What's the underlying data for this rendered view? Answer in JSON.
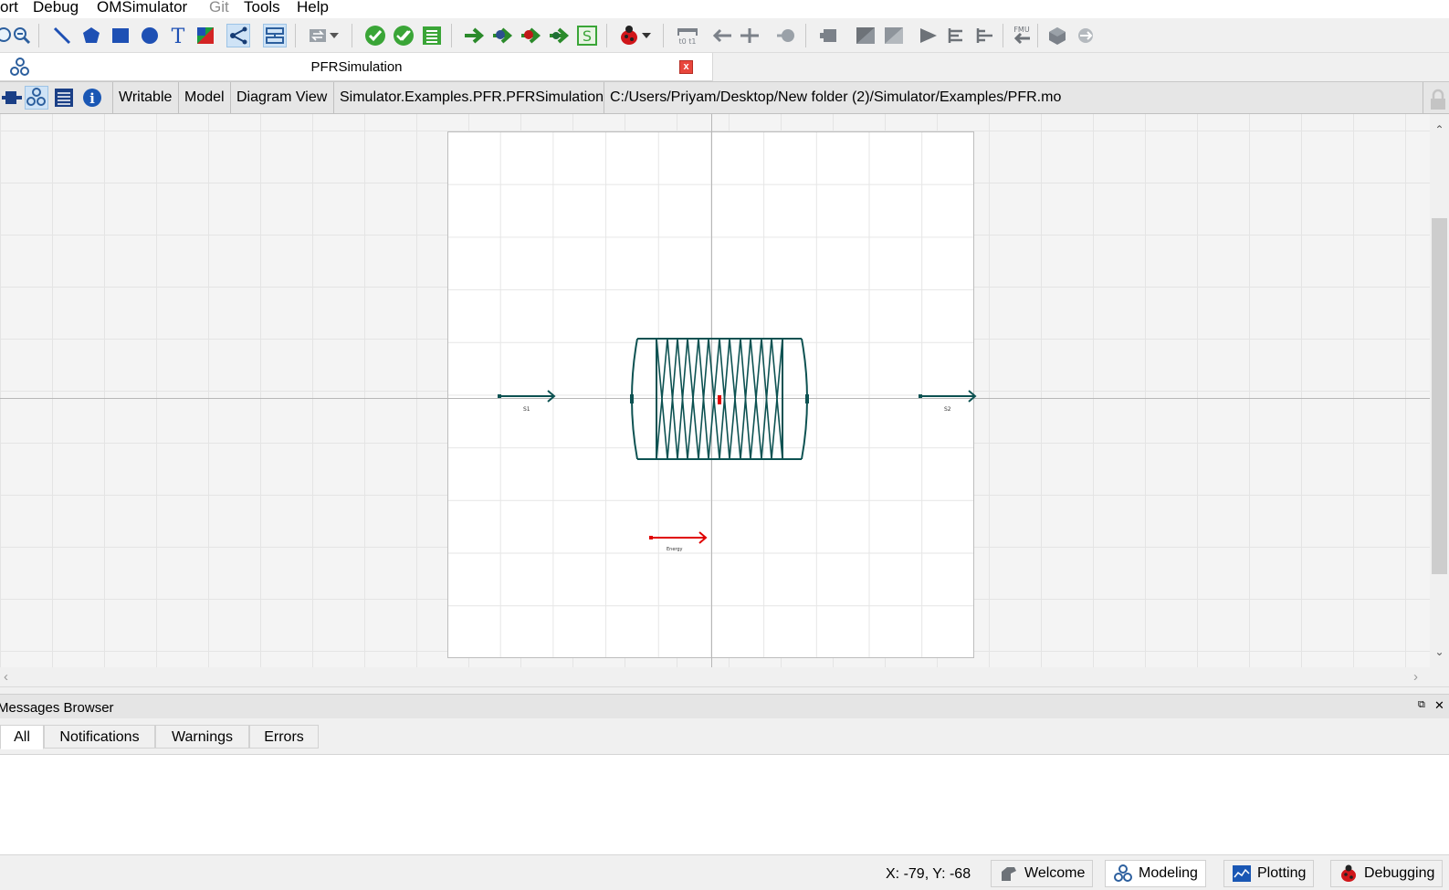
{
  "menubar": {
    "items": [
      {
        "label": "ort",
        "enabled": true
      },
      {
        "label": "Debug",
        "enabled": true
      },
      {
        "label": "OMSimulator",
        "enabled": true
      },
      {
        "label": "Git",
        "enabled": false
      },
      {
        "label": "Tools",
        "enabled": true
      },
      {
        "label": "Help",
        "enabled": true
      }
    ]
  },
  "toolbar": {
    "icons": [
      "zoom-out-icon",
      "line-tool-icon",
      "polygon-tool-icon",
      "rectangle-tool-icon",
      "ellipse-tool-icon",
      "text-tool-icon",
      "bitmap-tool-icon",
      "connect-mode-icon",
      "transition-mode-icon",
      "swap-icon",
      "check-model-icon",
      "check-all-models-icon",
      "instantiate-model-icon",
      "simulate-icon",
      "simulate-with-transformational-debugger-icon",
      "simulate-with-algorithmic-debugger-icon",
      "simulate-with-animation-icon",
      "simulation-setup-icon",
      "debug-icon",
      "diff-icon",
      "reroute-icon",
      "split-icon",
      "pin-icon",
      "export-fmu-icon",
      "component-icon",
      "import-icon",
      "import-all-icon",
      "send-icon",
      "align-left-icon",
      "align-right-icon",
      "fmu-import-icon",
      "cube-icon",
      "generate-icon"
    ]
  },
  "document_tab": {
    "title": "PFRSimulation",
    "close_label": "x"
  },
  "infobar": {
    "access": "Writable",
    "class_type": "Model",
    "view": "Diagram View",
    "class_name": "Simulator.Examples.PFR.PFRSimulation",
    "file_path": "C:/Users/Priyam/Desktop/New folder (2)/Simulator/Examples/PFR.mo"
  },
  "diagram": {
    "components": [
      {
        "name": "S1",
        "label": "S1",
        "type": "material-stream",
        "color": "#0d5252"
      },
      {
        "name": "S2",
        "label": "S2",
        "type": "material-stream",
        "color": "#0d5252"
      },
      {
        "name": "PFR",
        "label": "",
        "type": "plug-flow-reactor",
        "color": "#0d5252"
      },
      {
        "name": "Energy",
        "label": "Energy",
        "type": "energy-stream",
        "color": "#e00000"
      }
    ]
  },
  "messages": {
    "title": "Messages Browser",
    "tabs": [
      "All",
      "Notifications",
      "Warnings",
      "Errors"
    ],
    "active_tab": "All"
  },
  "statusbar": {
    "coordinates": "X: -79, Y: -68",
    "perspectives": [
      {
        "label": "Welcome",
        "active": false
      },
      {
        "label": "Modeling",
        "active": true
      },
      {
        "label": "Plotting",
        "active": false
      },
      {
        "label": "Debugging",
        "active": false
      }
    ]
  },
  "colors": {
    "accent_teal": "#0d5252",
    "energy_red": "#e00000",
    "active_tool": "#cfe3f6"
  }
}
